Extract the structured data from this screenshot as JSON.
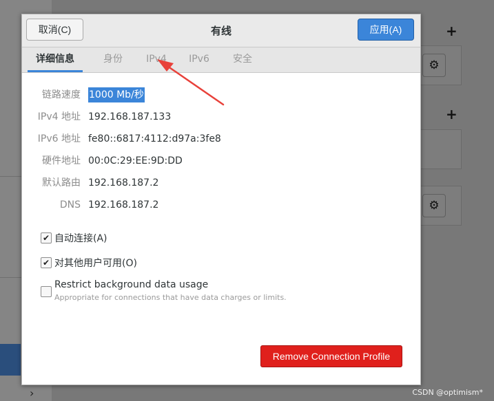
{
  "dialog": {
    "title": "有线",
    "cancel_label": "取消(C)",
    "apply_label": "应用(A)",
    "tabs": [
      {
        "label": "详细信息",
        "active": true
      },
      {
        "label": "身份",
        "active": false
      },
      {
        "label": "IPv4",
        "active": false
      },
      {
        "label": "IPv6",
        "active": false
      },
      {
        "label": "安全",
        "active": false
      }
    ],
    "details": [
      {
        "label": "链路速度",
        "value": "1000 Mb/秒"
      },
      {
        "label": "IPv4 地址",
        "value": "192.168.187.133"
      },
      {
        "label": "IPv6 地址",
        "value": "fe80::6817:4112:d97a:3fe8"
      },
      {
        "label": "硬件地址",
        "value": "00:0C:29:EE:9D:DD"
      },
      {
        "label": "默认路由",
        "value": "192.168.187.2"
      },
      {
        "label": "DNS",
        "value": "192.168.187.2"
      }
    ],
    "auto_connect": {
      "label": "自动连接(A)",
      "checked": true
    },
    "all_users": {
      "label": "对其他用户可用(O)",
      "checked": true
    },
    "restrict_bg": {
      "label": "Restrict background data usage",
      "sublabel": "Appropriate for connections that have data charges or limits.",
      "checked": false
    },
    "remove_label": "Remove Connection Profile"
  },
  "background": {
    "plus_glyph": "+",
    "gear_icon": "gear-icon",
    "chevron_icon": "chevron-right-icon"
  },
  "watermark": "CSDN @optimism*",
  "colors": {
    "accent": "#3b85d9",
    "destructive": "#e0201c",
    "annotation_arrow": "#e8413a"
  }
}
